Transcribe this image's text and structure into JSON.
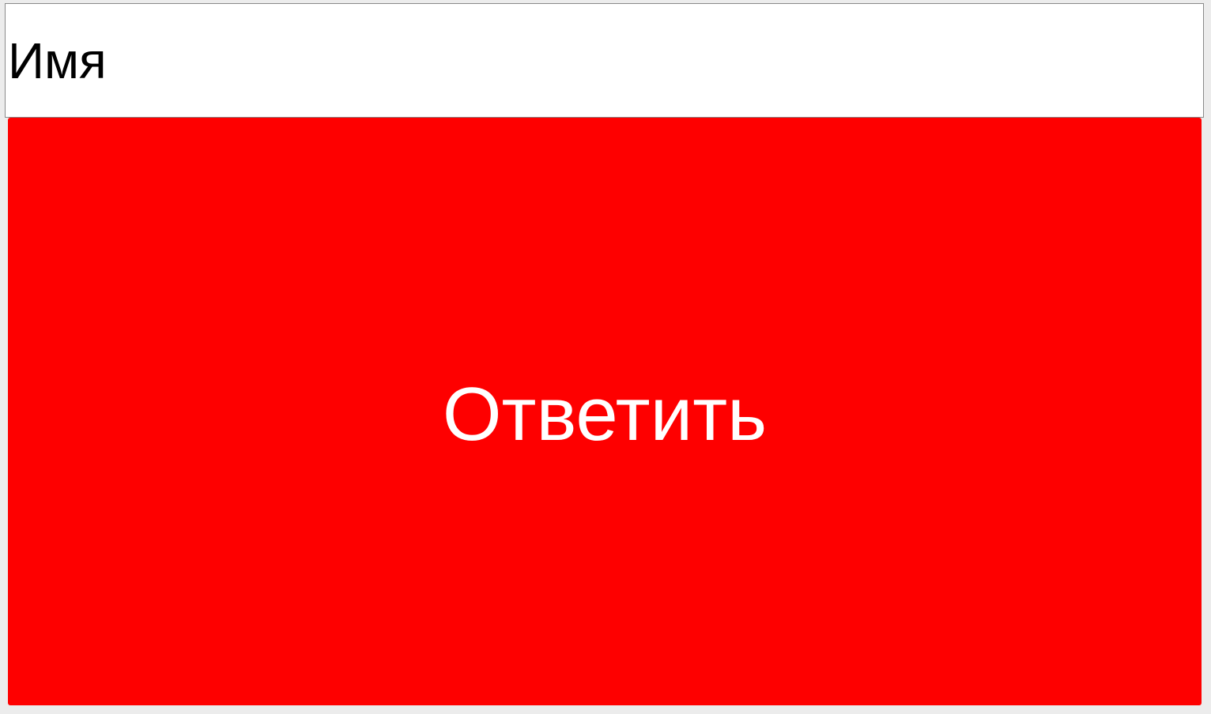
{
  "form": {
    "name_input": {
      "value": "",
      "placeholder": "Имя"
    },
    "reply_button": {
      "label": "Ответить",
      "color": "#fe0000",
      "text_color": "#ffffff"
    }
  },
  "colors": {
    "page_background": "#ececec",
    "input_background": "#ffffff",
    "input_border": "#8a8a8a"
  }
}
